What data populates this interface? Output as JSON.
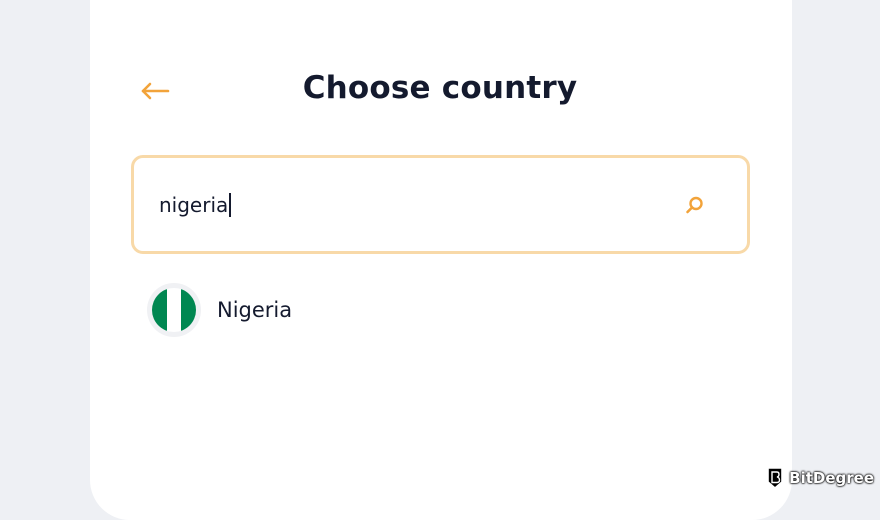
{
  "header": {
    "title": "Choose country",
    "back_icon": "arrow-left-icon"
  },
  "search": {
    "value": "nigeria",
    "icon": "search-icon"
  },
  "results": [
    {
      "name": "Nigeria",
      "flag_colors": [
        "#008751",
        "#ffffff",
        "#008751"
      ]
    }
  ],
  "colors": {
    "accent": "#f2a33a",
    "input_border": "#f8d9a8",
    "text": "#141a2e",
    "background": "#eef0f4"
  },
  "watermark": {
    "text": "BitDegree"
  }
}
